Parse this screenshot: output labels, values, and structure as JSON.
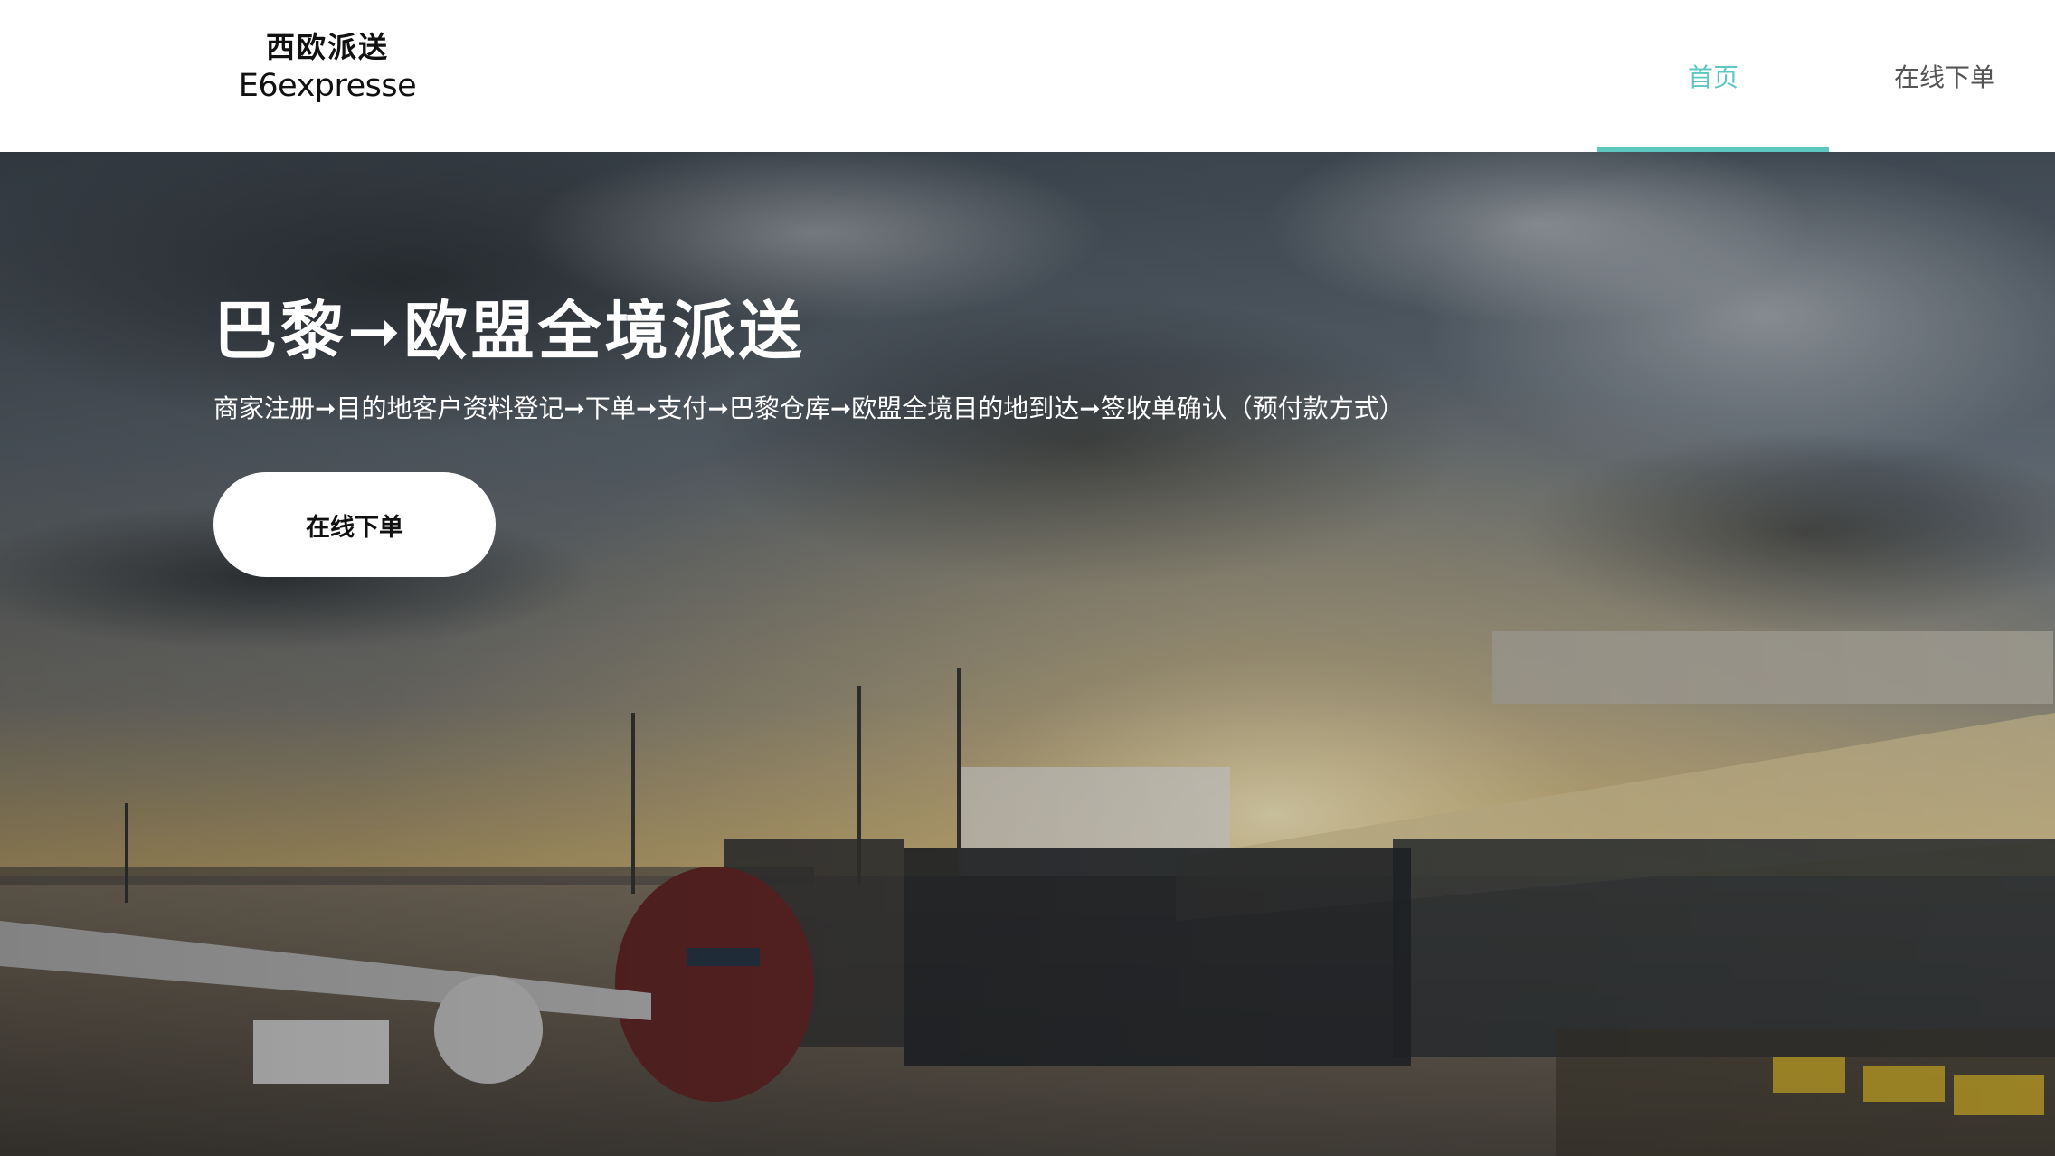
{
  "colors": {
    "accent": "#5ec8c0",
    "nav_inactive": "#555555",
    "header_bg": "#ffffff"
  },
  "logo": {
    "cn": "西欧派送",
    "en": "E6expresse"
  },
  "nav": {
    "items": [
      {
        "label": "首页",
        "active": true
      },
      {
        "label": "在线下单",
        "active": false
      }
    ]
  },
  "hero": {
    "title": "巴黎➞欧盟全境派送",
    "subtitle": "商家注册➞目的地客户资料登记➞下单➞支付➞巴黎仓库➞欧盟全境目的地到达➞签收单确认（预付款方式）",
    "cta_label": "在线下单",
    "background": "airport-apron-sunset-photo"
  }
}
